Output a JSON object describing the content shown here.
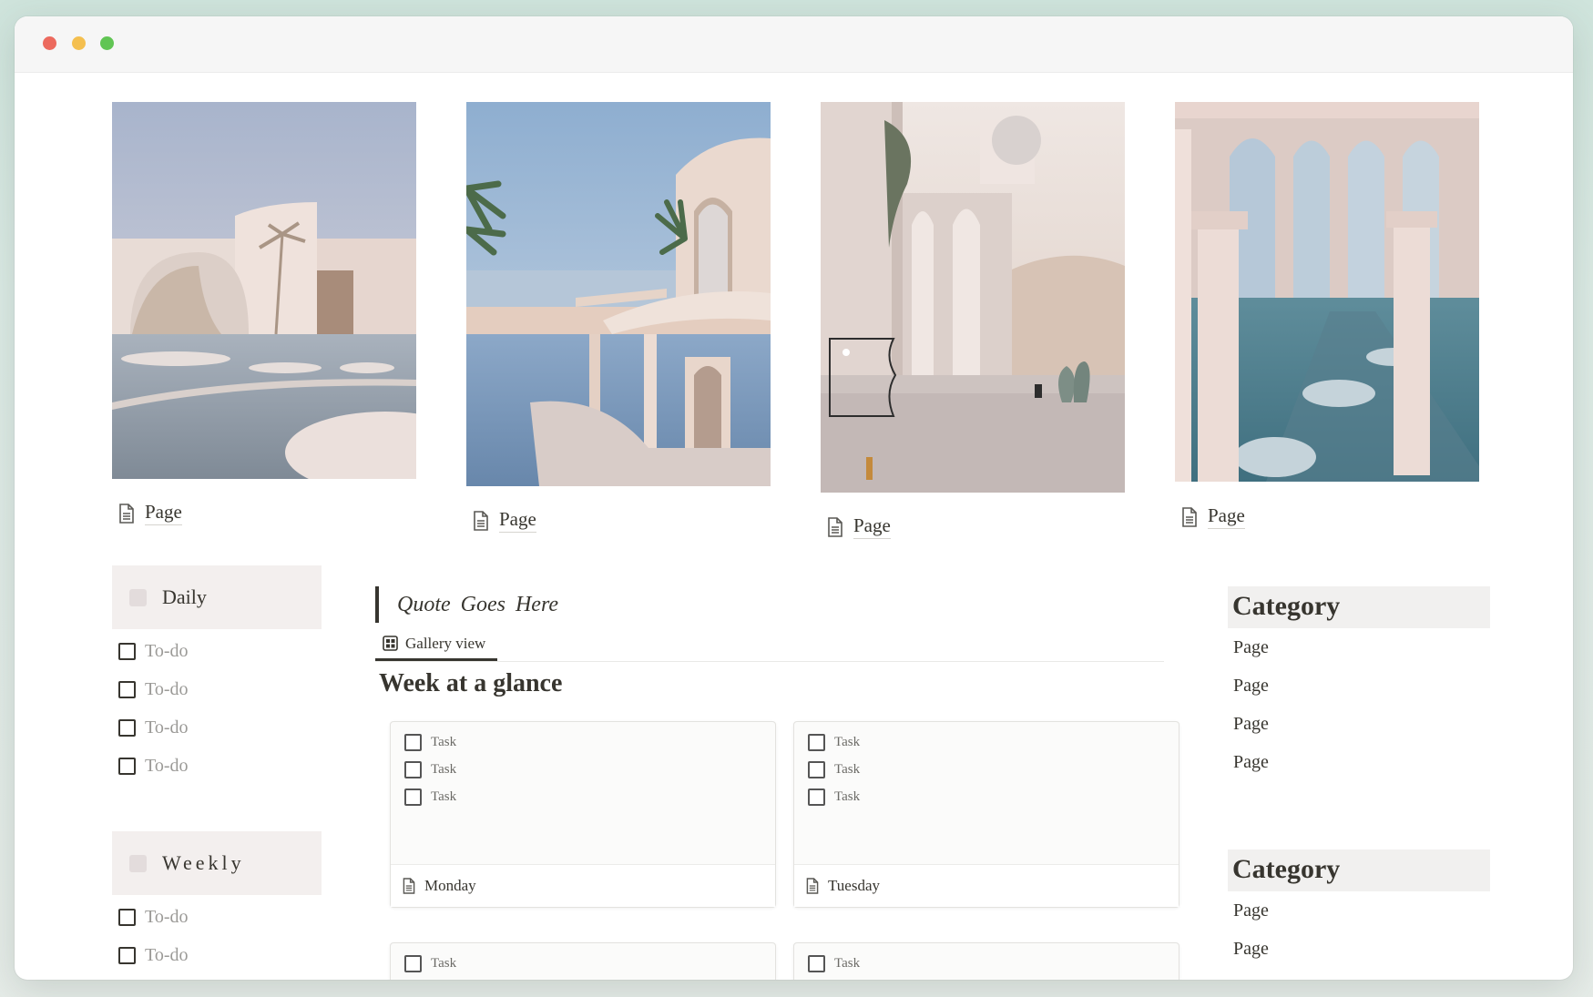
{
  "window": {
    "controls": [
      "close",
      "minimize",
      "maximize"
    ]
  },
  "gallery": {
    "cards": [
      {
        "label": "Page",
        "icon": "page-icon"
      },
      {
        "label": "Page",
        "icon": "page-icon"
      },
      {
        "label": "Page",
        "icon": "page-icon"
      },
      {
        "label": "Page",
        "icon": "page-icon"
      }
    ]
  },
  "left": {
    "daily": {
      "title": "Daily",
      "todos": [
        "To-do",
        "To-do",
        "To-do",
        "To-do"
      ]
    },
    "weekly": {
      "title": "Weekly",
      "todos": [
        "To-do",
        "To-do"
      ]
    }
  },
  "middle": {
    "quote": "Quote  Goes Here",
    "view_tab": "Gallery view",
    "heading": "Week at a glance",
    "days": [
      {
        "name": "Monday",
        "tasks": [
          "Task",
          "Task",
          "Task"
        ]
      },
      {
        "name": "Tuesday",
        "tasks": [
          "Task",
          "Task",
          "Task"
        ]
      },
      {
        "name": "",
        "tasks": [
          "Task"
        ]
      },
      {
        "name": "",
        "tasks": [
          "Task"
        ]
      }
    ]
  },
  "right": {
    "categories": [
      {
        "title": "Category",
        "pages": [
          "Page",
          "Page",
          "Page",
          "Page"
        ]
      },
      {
        "title": "Category",
        "pages": [
          "Page",
          "Page"
        ]
      }
    ]
  }
}
